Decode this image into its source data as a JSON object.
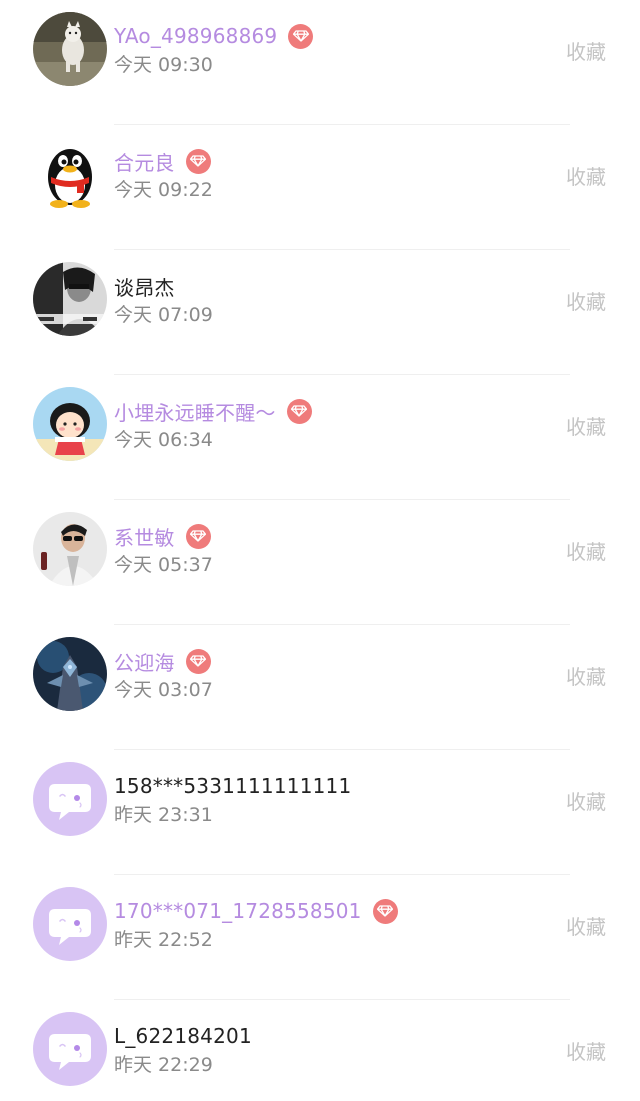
{
  "collect_label": "收藏",
  "colors": {
    "vip_name": "#b58be0",
    "plain_name": "#222222",
    "time": "#8a8a8a",
    "collect": "#c4c4c4",
    "badge": "#ef7b7b",
    "placeholder_avatar": "#d8c4f4"
  },
  "contacts": [
    {
      "name": "YAo_498968869",
      "vip": true,
      "time": "今天 09:30",
      "avatar": "dog-photo"
    },
    {
      "name": "合元良",
      "vip": true,
      "time": "今天 09:22",
      "avatar": "penguin-qq"
    },
    {
      "name": "谈昂杰",
      "vip": false,
      "time": "今天 07:09",
      "avatar": "person-bw-photo"
    },
    {
      "name": "小埋永远睡不醒～",
      "vip": true,
      "time": "今天 06:34",
      "avatar": "cartoon-girl"
    },
    {
      "name": "系世敏",
      "vip": true,
      "time": "今天 05:37",
      "avatar": "person-sunglasses-photo"
    },
    {
      "name": "公迎海",
      "vip": true,
      "time": "今天 03:07",
      "avatar": "game-character"
    },
    {
      "name": "158***5331111111111",
      "vip": false,
      "time": "昨天 23:31",
      "avatar": "chat-bubble-placeholder"
    },
    {
      "name": "170***071_1728558501",
      "vip": true,
      "time": "昨天 22:52",
      "avatar": "chat-bubble-placeholder"
    },
    {
      "name": "L_622184201",
      "vip": false,
      "time": "昨天 22:29",
      "avatar": "chat-bubble-placeholder"
    }
  ]
}
